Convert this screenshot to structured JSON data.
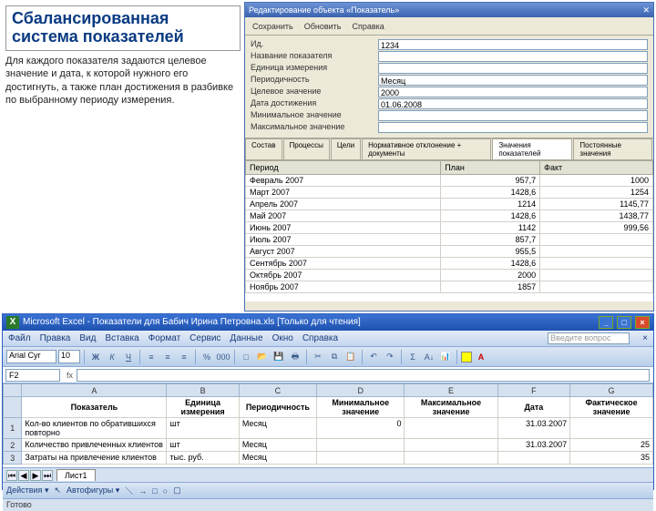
{
  "slide": {
    "title": "Сбалансированная система показателей",
    "desc": "Для каждого показателя задаются целевое значение и дата, к которой нужного его достигнуть, а также план достижения в разбивке по выбранному периоду измерения."
  },
  "win1": {
    "title": "Редактирование объекта «Показатель»",
    "buttons": {
      "save": "Сохранить",
      "refresh": "Обновить",
      "help": "Справка"
    },
    "form": {
      "label_id": "Ид.",
      "val_id": "1234",
      "label_name": "Название показателя",
      "val_name": "",
      "label_unit": "Единица измерения",
      "val_unit": "",
      "label_period": "Периодичность",
      "val_period": "Месяц",
      "label_target": "Целевое значение",
      "val_target": "2000",
      "label_date": "Дата достижения",
      "val_date": "01.06.2008",
      "label_min": "Минимальное значение",
      "val_min": "",
      "label_max": "Максимальное значение",
      "val_max": ""
    },
    "tabs": {
      "t1": "Состав",
      "t2": "Процессы",
      "t3": "Цели",
      "t4": "Нормативное отклонение + документы",
      "t5": "Значения показателей",
      "t6": "Постоянные значения"
    },
    "grid_headers": {
      "c1": "Период",
      "c2": "План",
      "c3": "Факт"
    },
    "grid": [
      {
        "p": "Февраль 2007",
        "a": "957,7",
        "b": "1000"
      },
      {
        "p": "Март 2007",
        "a": "1428,6",
        "b": "1254"
      },
      {
        "p": "Апрель 2007",
        "a": "1214",
        "b": "1145,77"
      },
      {
        "p": "Май 2007",
        "a": "1428,6",
        "b": "1438,77"
      },
      {
        "p": "Июнь 2007",
        "a": "1142",
        "b": "999,56"
      },
      {
        "p": "Июль 2007",
        "a": "857,7",
        "b": ""
      },
      {
        "p": "Август 2007",
        "a": "955,5",
        "b": ""
      },
      {
        "p": "Сентябрь 2007",
        "a": "1428,6",
        "b": ""
      },
      {
        "p": "Октябрь 2007",
        "a": "2000",
        "b": ""
      },
      {
        "p": "Ноябрь 2007",
        "a": "1857",
        "b": ""
      }
    ]
  },
  "excel": {
    "title": "Microsoft Excel - Показатели для Бабич Ирина Петровна.xls  [Только для чтения]",
    "menu": {
      "file": "Файл",
      "edit": "Правка",
      "view": "Вид",
      "insert": "Вставка",
      "format": "Формат",
      "tools": "Сервис",
      "data": "Данные",
      "window": "Окно",
      "help": "Справка",
      "ask": "Введите вопрос"
    },
    "font": {
      "name": "Arial Cyr",
      "size": "10"
    },
    "namebox": "F2",
    "fx": "fx",
    "cols": {
      "A": "A",
      "B": "B",
      "C": "C",
      "D": "D",
      "E": "E",
      "F": "F",
      "G": "G"
    },
    "headers": {
      "A": "Показатель",
      "B": "Единица измерения",
      "C": "Периодичность",
      "D": "Минимальное значение",
      "E": "Максимальное значение",
      "F": "Дата",
      "G": "Фактическое значение"
    },
    "rows": [
      {
        "n": "1",
        "A": "Кол-во клиентов по обратившихся повторно",
        "B": "шт",
        "C": "Месяц",
        "D": "0",
        "E": "",
        "F": "31.03.2007",
        "G": ""
      },
      {
        "n": "2",
        "A": "Количество привлеченных клиентов",
        "B": "шт",
        "C": "Месяц",
        "D": "",
        "E": "",
        "F": "31.03.2007",
        "G": "25"
      },
      {
        "n": "3",
        "A": "Затраты на привлечение клиентов",
        "B": "тыс. руб.",
        "C": "Месяц",
        "D": "",
        "E": "",
        "F": "",
        "G": "35"
      }
    ],
    "sheet_tab": "Лист1",
    "draw": {
      "actions": "Действия",
      "autoshapes": "Автофигуры"
    },
    "status": "Готово"
  }
}
